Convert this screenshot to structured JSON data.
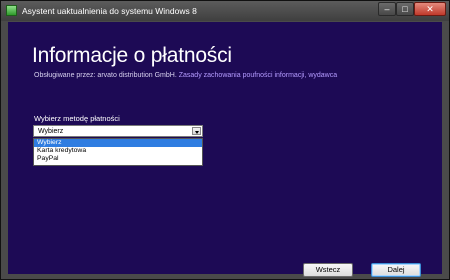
{
  "window": {
    "title": "Asystent uaktualnienia do systemu Windows 8",
    "minimize_glyph": "–",
    "maximize_glyph": "□",
    "close_glyph": "✕"
  },
  "page": {
    "heading": "Informacje o płatności",
    "support_prefix": "Obsługiwane przez: arvato distribution GmbH.",
    "support_link": "Zasady zachowania poufności informacji, wydawca"
  },
  "payment_method": {
    "label": "Wybierz metodę płatności",
    "selected": "Wybierz",
    "options": [
      "Wybierz",
      "Karta kredytowa",
      "PayPal"
    ]
  },
  "buttons": {
    "back": "Wstecz",
    "next": "Dalej"
  },
  "colors": {
    "content_background": "#1d0a55",
    "link": "#b49bff",
    "selection": "#2f7de1"
  }
}
